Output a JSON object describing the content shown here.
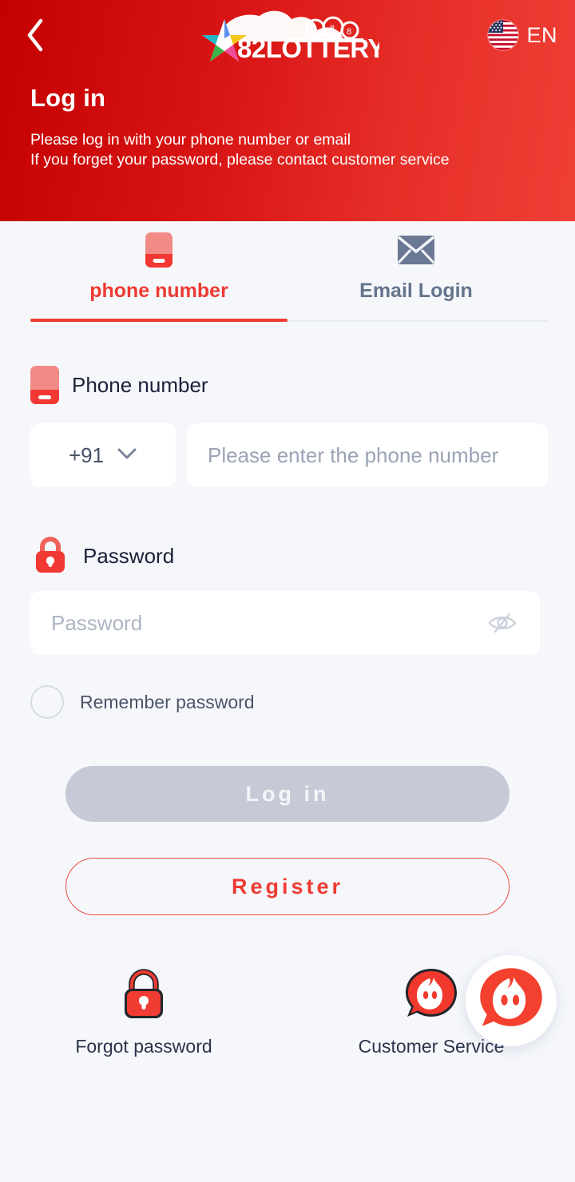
{
  "header": {
    "back_icon": "chevron-left-icon",
    "logo_text": "82LOTTERY",
    "language_code": "EN",
    "flag_icon": "us-flag-icon",
    "title": "Log in",
    "subtitle_line1": "Please log in with your phone number or email",
    "subtitle_line2": "If you forget your password, please contact customer service",
    "gradient_from": "#c50000",
    "gradient_to": "#ef4036"
  },
  "tabs": [
    {
      "label": "phone number",
      "icon": "phone-icon",
      "active": true
    },
    {
      "label": "Email Login",
      "icon": "envelope-icon",
      "active": false
    }
  ],
  "form": {
    "phone_label": "Phone number",
    "phone_label_icon": "phone-icon",
    "country_code": "+91",
    "country_code_chevron": "chevron-down-icon",
    "phone_placeholder": "Please enter the phone number",
    "phone_value": "",
    "password_label": "Password",
    "password_label_icon": "lock-icon",
    "password_placeholder": "Password",
    "password_value": "",
    "password_toggle_icon": "eye-off-icon",
    "remember_label": "Remember password",
    "remember_checked": false
  },
  "actions": {
    "login_label": "Log in",
    "login_disabled": true,
    "register_label": "Register",
    "login_bg": "#c7cad6",
    "register_border": "#ee4a43"
  },
  "bottom": [
    {
      "label": "Forgot password",
      "icon": "padlock-icon"
    },
    {
      "label": "Customer Service",
      "icon": "support-chat-icon"
    }
  ],
  "floating": {
    "icon": "support-chat-icon",
    "accent": "#f4402e"
  },
  "colors": {
    "accent_red": "#ee3b33",
    "page_bg": "#f5f7fb",
    "muted_text": "#64748b"
  }
}
